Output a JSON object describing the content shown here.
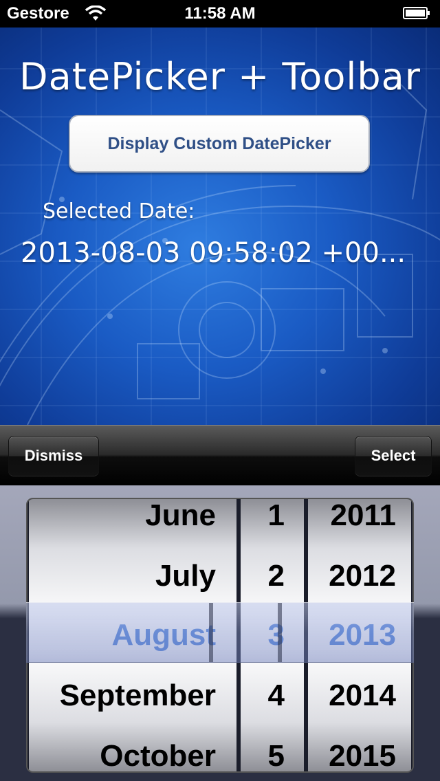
{
  "status_bar": {
    "carrier": "Gestore",
    "time": "11:58 AM",
    "wifi_icon": "wifi-icon",
    "battery_icon": "battery-icon"
  },
  "app": {
    "title": "DatePicker + Toolbar",
    "display_button_label": "Display Custom DatePicker",
    "selected_label": "Selected Date:",
    "selected_value": "2013-08-03 09:58:02 +00..."
  },
  "toolbar": {
    "dismiss_label": "Dismiss",
    "select_label": "Select"
  },
  "picker": {
    "months": [
      "June",
      "July",
      "August",
      "September",
      "October"
    ],
    "days": [
      "1",
      "2",
      "3",
      "4",
      "5"
    ],
    "years": [
      "2011",
      "2012",
      "2013",
      "2014",
      "2015"
    ],
    "selected_month": "August",
    "selected_day": "3",
    "selected_year": "2013"
  },
  "colors": {
    "selected_text": "#5486de",
    "button_text": "#2f4f86",
    "background_blue": "#1a5bc4"
  }
}
